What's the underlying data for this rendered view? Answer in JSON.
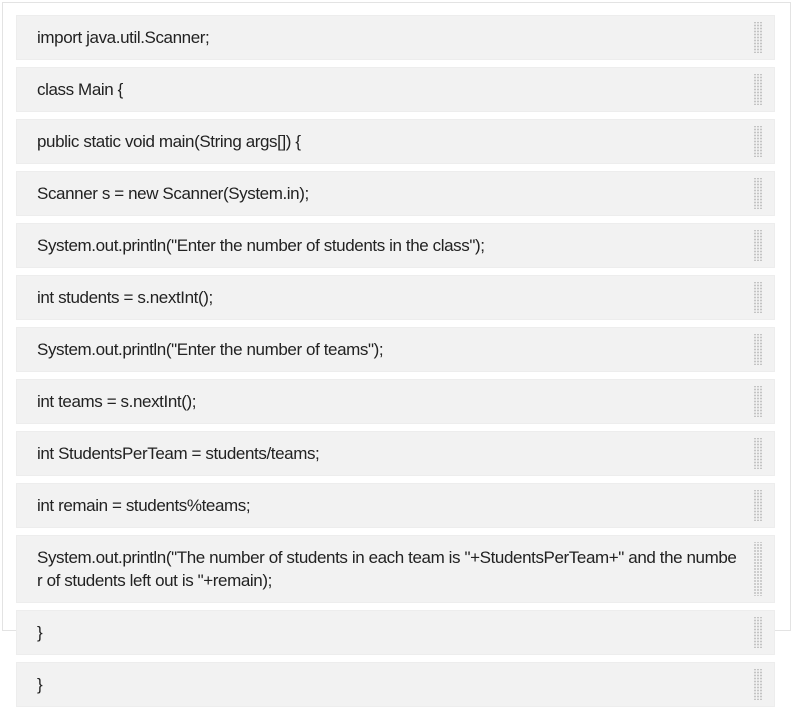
{
  "code_lines": [
    "import java.util.Scanner;",
    "class Main  {",
    "public static void main(String args[]) {",
    "Scanner s = new Scanner(System.in);",
    "System.out.println(\"Enter the number of students in the class\");",
    "int students = s.nextInt();",
    "System.out.println(\"Enter the number of teams\");",
    "int teams = s.nextInt();",
    "int StudentsPerTeam = students/teams;",
    "int remain = students%teams;",
    "System.out.println(\"The number of students in each team is \"+StudentsPerTeam+\" and the number of students left out is \"+remain);",
    "}",
    "}"
  ],
  "icons": {
    "drag_handle": "drag-handle-icon"
  }
}
